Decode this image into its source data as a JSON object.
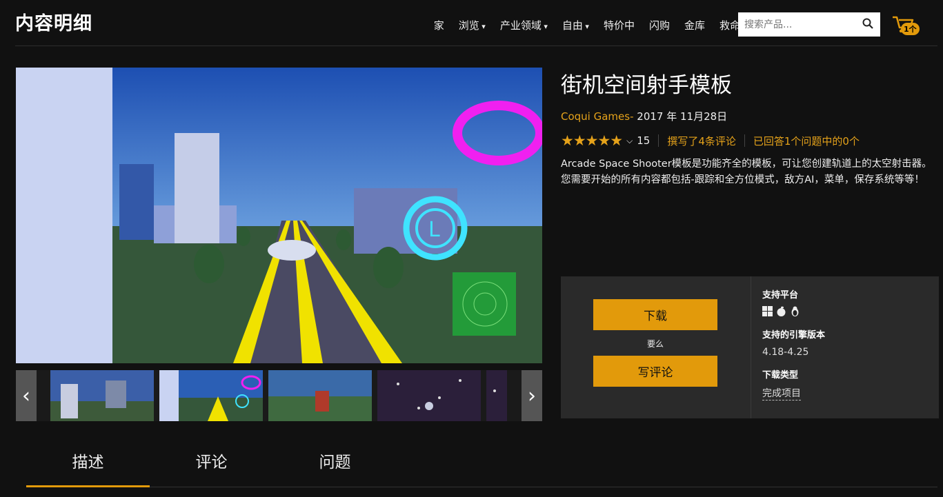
{
  "header": {
    "logo": "内容明细",
    "nav": [
      {
        "label": "家",
        "caret": false
      },
      {
        "label": "浏览",
        "caret": true
      },
      {
        "label": "产业领域",
        "caret": true
      },
      {
        "label": "自由",
        "caret": true
      },
      {
        "label": "特价中",
        "caret": false
      },
      {
        "label": "闪购",
        "caret": false
      },
      {
        "label": "金库",
        "caret": false
      },
      {
        "label": "救命",
        "caret": false
      }
    ],
    "search_placeholder": "搜索产品...",
    "cart_count": "1个"
  },
  "product": {
    "title": "街机空间射手模板",
    "publisher": "Coqui Games",
    "publisher_dash": "-",
    "date": "2017 年 11月28日",
    "rating": 4.5,
    "rating_count": "15",
    "reviews_link": "撰写了4条评论",
    "questions_link": "已回答1个问题中的0个",
    "description": "Arcade Space Shooter模板是功能齐全的模板，可让您创建轨道上的太空射击器。您需要开始的所有内容都包括-跟踪和全方位模式，敌方AI，菜单，保存系统等等！"
  },
  "panel": {
    "download_label": "下载",
    "or_label": "要么",
    "review_label": "写评论",
    "platforms_label": "支持平台",
    "platforms": [
      "windows-icon",
      "apple-icon",
      "linux-icon"
    ],
    "engine_label": "支持的引擎版本",
    "engine_value": "4.18-4.25",
    "download_type_label": "下载类型",
    "download_type_value": "完成项目"
  },
  "tabs": [
    {
      "label": "描述",
      "active": true
    },
    {
      "label": "评论",
      "active": false
    },
    {
      "label": "问题",
      "active": false
    }
  ],
  "colors": {
    "accent": "#e29a0b",
    "background": "#111111",
    "panel": "#2a2a2a"
  }
}
